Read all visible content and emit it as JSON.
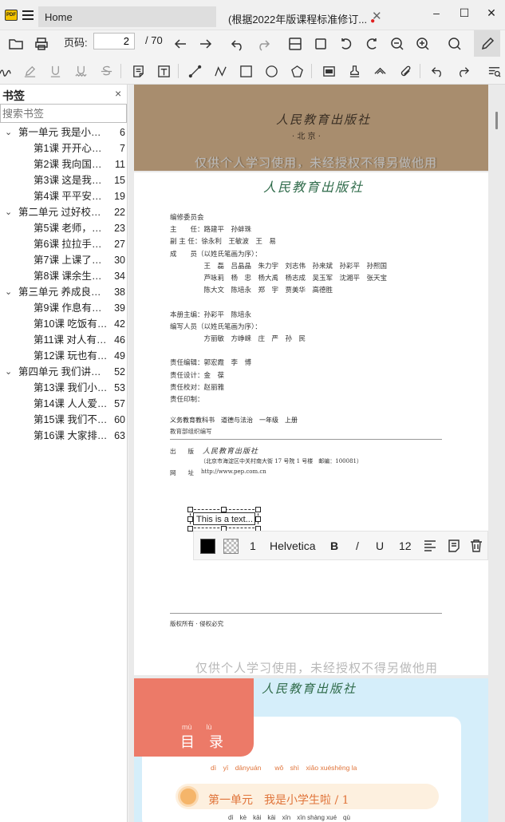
{
  "titlebar": {
    "app_logo_text": "PDF",
    "tab_home": "Home",
    "tab_doc": "(根据2022年版课程标准修订...",
    "tab_close": "✕",
    "minimize": "–",
    "maximize": "☐",
    "close": "✕"
  },
  "toolbar": {
    "page_label": "页码:",
    "page_value": "2",
    "page_total": "/ 70"
  },
  "sidebar": {
    "title": "书签",
    "close": "×",
    "search_placeholder": "搜索书签",
    "items": [
      {
        "label": "第一单元 我是小学生啦",
        "page": "6",
        "level": 0
      },
      {
        "label": "第1课 开开心心上学去",
        "page": "7",
        "level": 1
      },
      {
        "label": "第2课 我向国旗敬个礼",
        "page": "11",
        "level": 1
      },
      {
        "label": "第3课 这是我们的校园",
        "page": "15",
        "level": 1
      },
      {
        "label": "第4课 平平安安回家来",
        "page": "19",
        "level": 1
      },
      {
        "label": "第二单元 过好校园生活",
        "page": "22",
        "level": 0
      },
      {
        "label": "第5课 老师，您好！",
        "page": "23",
        "level": 1
      },
      {
        "label": "第6课 拉拉手，交朋友",
        "page": "27",
        "level": 1
      },
      {
        "label": "第7课 上课了，好好学",
        "page": "30",
        "level": 1
      },
      {
        "label": "第8课 课余生活真丰富",
        "page": "34",
        "level": 1
      },
      {
        "label": "第三单元 养成良好习惯",
        "page": "38",
        "level": 0
      },
      {
        "label": "第9课 作息有规律",
        "page": "39",
        "level": 1
      },
      {
        "label": "第10课 吃饭有讲究",
        "page": "42",
        "level": 1
      },
      {
        "label": "第11课 对人有礼貌",
        "page": "46",
        "level": 1
      },
      {
        "label": "第12课 玩也有学问",
        "page": "49",
        "level": 1
      },
      {
        "label": "第四单元 我们讲文明",
        "page": "52",
        "level": 0
      },
      {
        "label": "第13课 我们小点儿声",
        "page": "53",
        "level": 1
      },
      {
        "label": "第14课 人人爱护公物",
        "page": "57",
        "level": 1
      },
      {
        "label": "第15课 我们不乱扔",
        "page": "60",
        "level": 1
      },
      {
        "label": "第16课 大家排好队",
        "page": "63",
        "level": 1
      }
    ]
  },
  "document": {
    "page1": {
      "publisher": "人民教育出版社",
      "city": "· 北 京 ·",
      "watermark": "仅供个人学习使用，未经授权不得另做他用"
    },
    "page2": {
      "publisher": "人民教育出版社",
      "credits": [
        "编修委员会",
        "主　　任：路建平　孙蚌珠",
        "副 主 任：徐永利　王敏波　王　易",
        "成　　员（以姓氏笔画为序）：",
        "　　　　　王　磊　吕晶晶　朱力宇　刘志伟　孙来斌　孙彩平　孙熙国",
        "　　　　　芦咏莉　杨　忠　杨大禹　杨志成　吴玉军　沈湘平　张天宝",
        "　　　　　陈大文　陈培永　郑　宇　贾美华　高德胜",
        "",
        "本册主编：孙彩平　陈培永",
        "编写人员（以姓氏笔画为序）：",
        "　　　　　方丽敏　方峥崃　庄　严　孙　民",
        "",
        "责任编辑：郭宏霞　李　博",
        "责任设计：金　葆",
        "责任校对：赵丽雅",
        "责任印制："
      ],
      "book_title": "义务教育教科书　道德与法治　一年级　上册",
      "compiled_by": "教育部组织编写",
      "publisher_label": "出　　版",
      "address": "（北京市海淀区中关村南大街 17 号院 1 号楼　邮编：100081）",
      "website_label": "网　　址",
      "website": "http://www.pep.com.cn",
      "textbox": "This is a text...",
      "copyright": "版权所有 · 侵权必究",
      "watermark": "仅供个人学习使用，未经授权不得另做他用"
    },
    "page3": {
      "publisher": "人民教育出版社",
      "toc_pinyin": "mù　　lù",
      "toc_title": "目　录",
      "unit_pinyin": "dì　yī　dānyuán　　wǒ　shì　xiǎo xuéshēng la",
      "unit_title": "第一单元　我是小学生啦 / 1",
      "lesson_pinyin": "dì　kè　kāi　kāi　xīn　xīn shàng xué　qù"
    }
  },
  "format_bar": {
    "line_width": "1",
    "font": "Helvetica",
    "bold": "B",
    "italic": "/",
    "underline": "U",
    "font_size": "12",
    "fill_color": "#000000"
  },
  "colors": {
    "accent_bar": "#dcdcdc",
    "page1_bg": "#a88d6e",
    "page3_bg": "#d5eefa",
    "page3_red": "#ec7a68",
    "publisher_green": "#2f6b4a"
  }
}
